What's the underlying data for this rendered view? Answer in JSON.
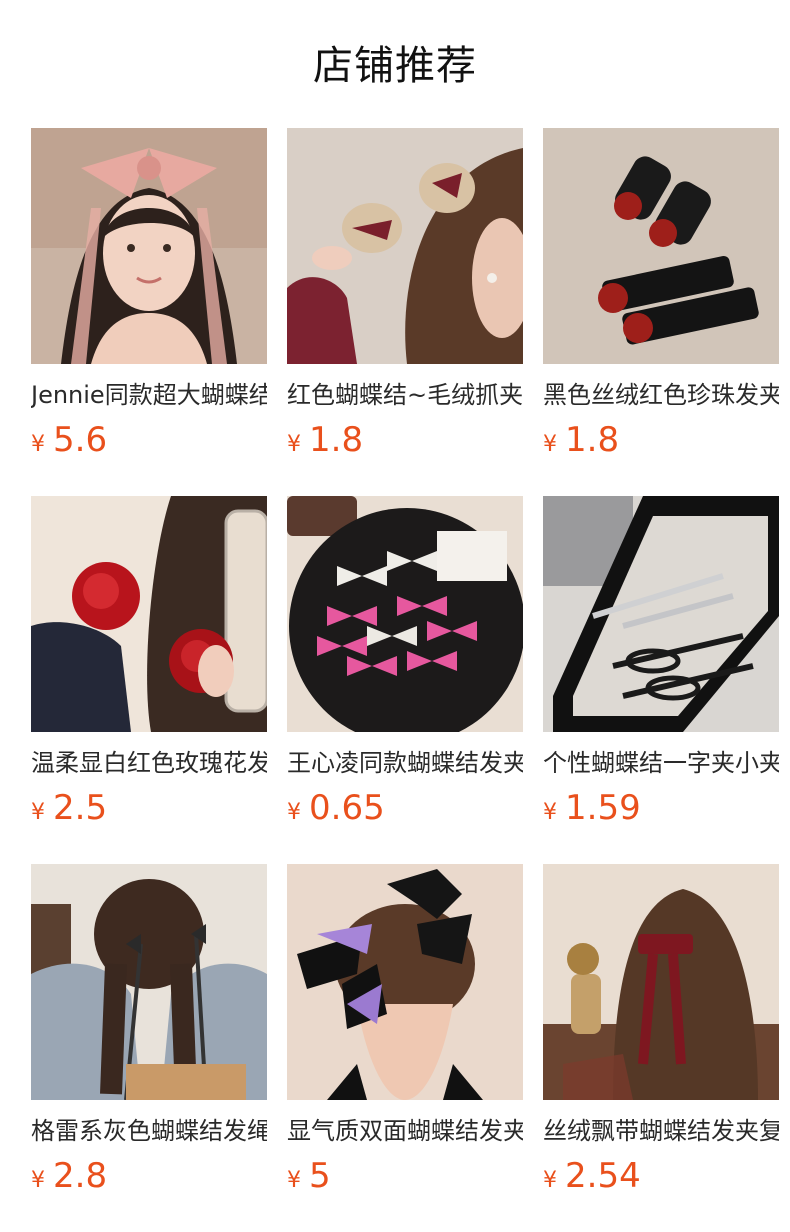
{
  "section": {
    "title": "店铺推荐"
  },
  "currency_symbol": "¥",
  "products": [
    {
      "name": "Jennie同款超大蝴蝶结发夹",
      "price": "5.6",
      "image_icon": "pink-ribbon-bow-photo"
    },
    {
      "name": "红色蝴蝶结~毛绒抓夹",
      "price": "1.8",
      "image_icon": "plush-bear-claw-clip-photo"
    },
    {
      "name": "黑色丝绒红色珍珠发夹",
      "price": "1.8",
      "image_icon": "velvet-pearl-hair-clips-photo"
    },
    {
      "name": "温柔显白红色玫瑰花发圈",
      "price": "2.5",
      "image_icon": "red-rose-scrunchie-photo"
    },
    {
      "name": "王心凌同款蝴蝶结发夹",
      "price": "0.65",
      "image_icon": "pink-white-bows-plate-photo"
    },
    {
      "name": "个性蝴蝶结一字夹小夹子",
      "price": "1.59",
      "image_icon": "silver-black-bow-pins-photo"
    },
    {
      "name": "格雷系灰色蝴蝶结发绳",
      "price": "2.8",
      "image_icon": "grey-ribbon-braids-photo"
    },
    {
      "name": "显气质双面蝴蝶结发夹",
      "price": "5",
      "image_icon": "black-purple-bow-bun-photo"
    },
    {
      "name": "丝绒飘带蝴蝶结发夹复古",
      "price": "2.54",
      "image_icon": "red-velvet-ribbon-photo"
    }
  ],
  "colors": {
    "price": "#e9501c",
    "title": "#111111"
  }
}
